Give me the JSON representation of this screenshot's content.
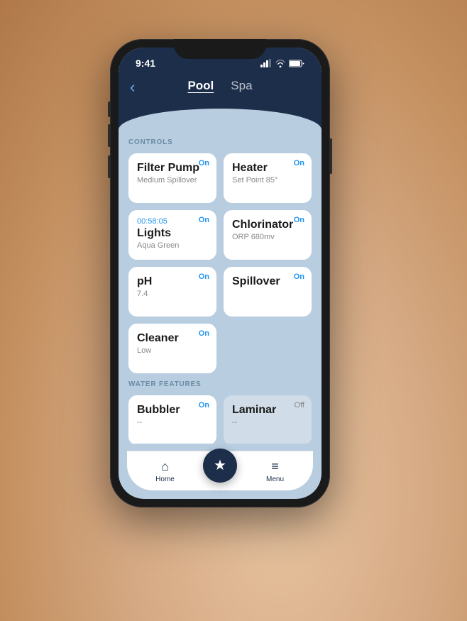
{
  "status_bar": {
    "time": "9:41"
  },
  "header": {
    "back_label": "‹",
    "tab_pool": "Pool",
    "tab_spa": "Spa"
  },
  "sections": {
    "controls_label": "CONTROLS",
    "water_features_label": "WATER FEATURES"
  },
  "controls": [
    {
      "id": "filter-pump",
      "title": "Filter Pump",
      "subtitle": "Medium Spillover",
      "status": "On",
      "timer": null
    },
    {
      "id": "heater",
      "title": "Heater",
      "subtitle": "Set Point 85°",
      "status": "On",
      "timer": null
    },
    {
      "id": "lights",
      "title": "Lights",
      "subtitle": "Aqua Green",
      "status": "On",
      "timer": "00:58:05"
    },
    {
      "id": "chlorinator",
      "title": "Chlorinator",
      "subtitle": "ORP 680mv",
      "status": "On",
      "timer": null
    },
    {
      "id": "ph",
      "title": "pH",
      "subtitle": "7.4",
      "status": "On",
      "timer": null
    },
    {
      "id": "spillover",
      "title": "Spillover",
      "subtitle": "",
      "status": "On",
      "timer": null
    },
    {
      "id": "cleaner",
      "title": "Cleaner",
      "subtitle": "Low",
      "status": "On",
      "timer": null,
      "full_width": true
    }
  ],
  "water_features": [
    {
      "id": "bubbler",
      "title": "Bubbler",
      "subtitle": "--",
      "status": "On",
      "off": false
    },
    {
      "id": "laminar",
      "title": "Laminar",
      "subtitle": "--",
      "status": "Off",
      "off": true
    }
  ],
  "nav": {
    "home_label": "Home",
    "menu_label": "Menu",
    "fab_icon": "★"
  }
}
